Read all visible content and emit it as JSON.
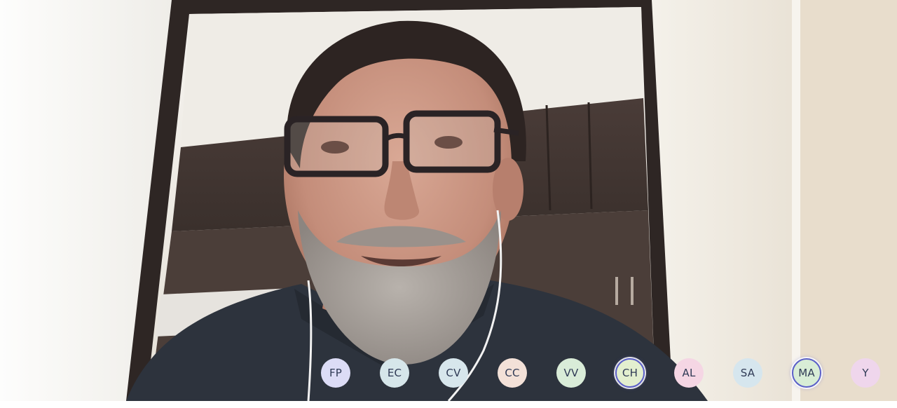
{
  "participants": [
    {
      "initials": "FP",
      "bg": "#dcdcf6",
      "active": false
    },
    {
      "initials": "EC",
      "bg": "#d6e6ea",
      "active": false
    },
    {
      "initials": "CV",
      "bg": "#d7e6ec",
      "active": false
    },
    {
      "initials": "CC",
      "bg": "#f3e1d8",
      "active": false
    },
    {
      "initials": "VV",
      "bg": "#d9ecd8",
      "active": false
    },
    {
      "initials": "CH",
      "bg": "#e3efcf",
      "active": true
    },
    {
      "initials": "AL",
      "bg": "#f5d6e4",
      "active": false
    },
    {
      "initials": "SA",
      "bg": "#d6e6ee",
      "active": false
    },
    {
      "initials": "MA",
      "bg": "#d8edd6",
      "active": true
    },
    {
      "initials": "Y",
      "bg": "#efd6ec",
      "active": false
    }
  ],
  "accent_color": "#5b5fc7"
}
